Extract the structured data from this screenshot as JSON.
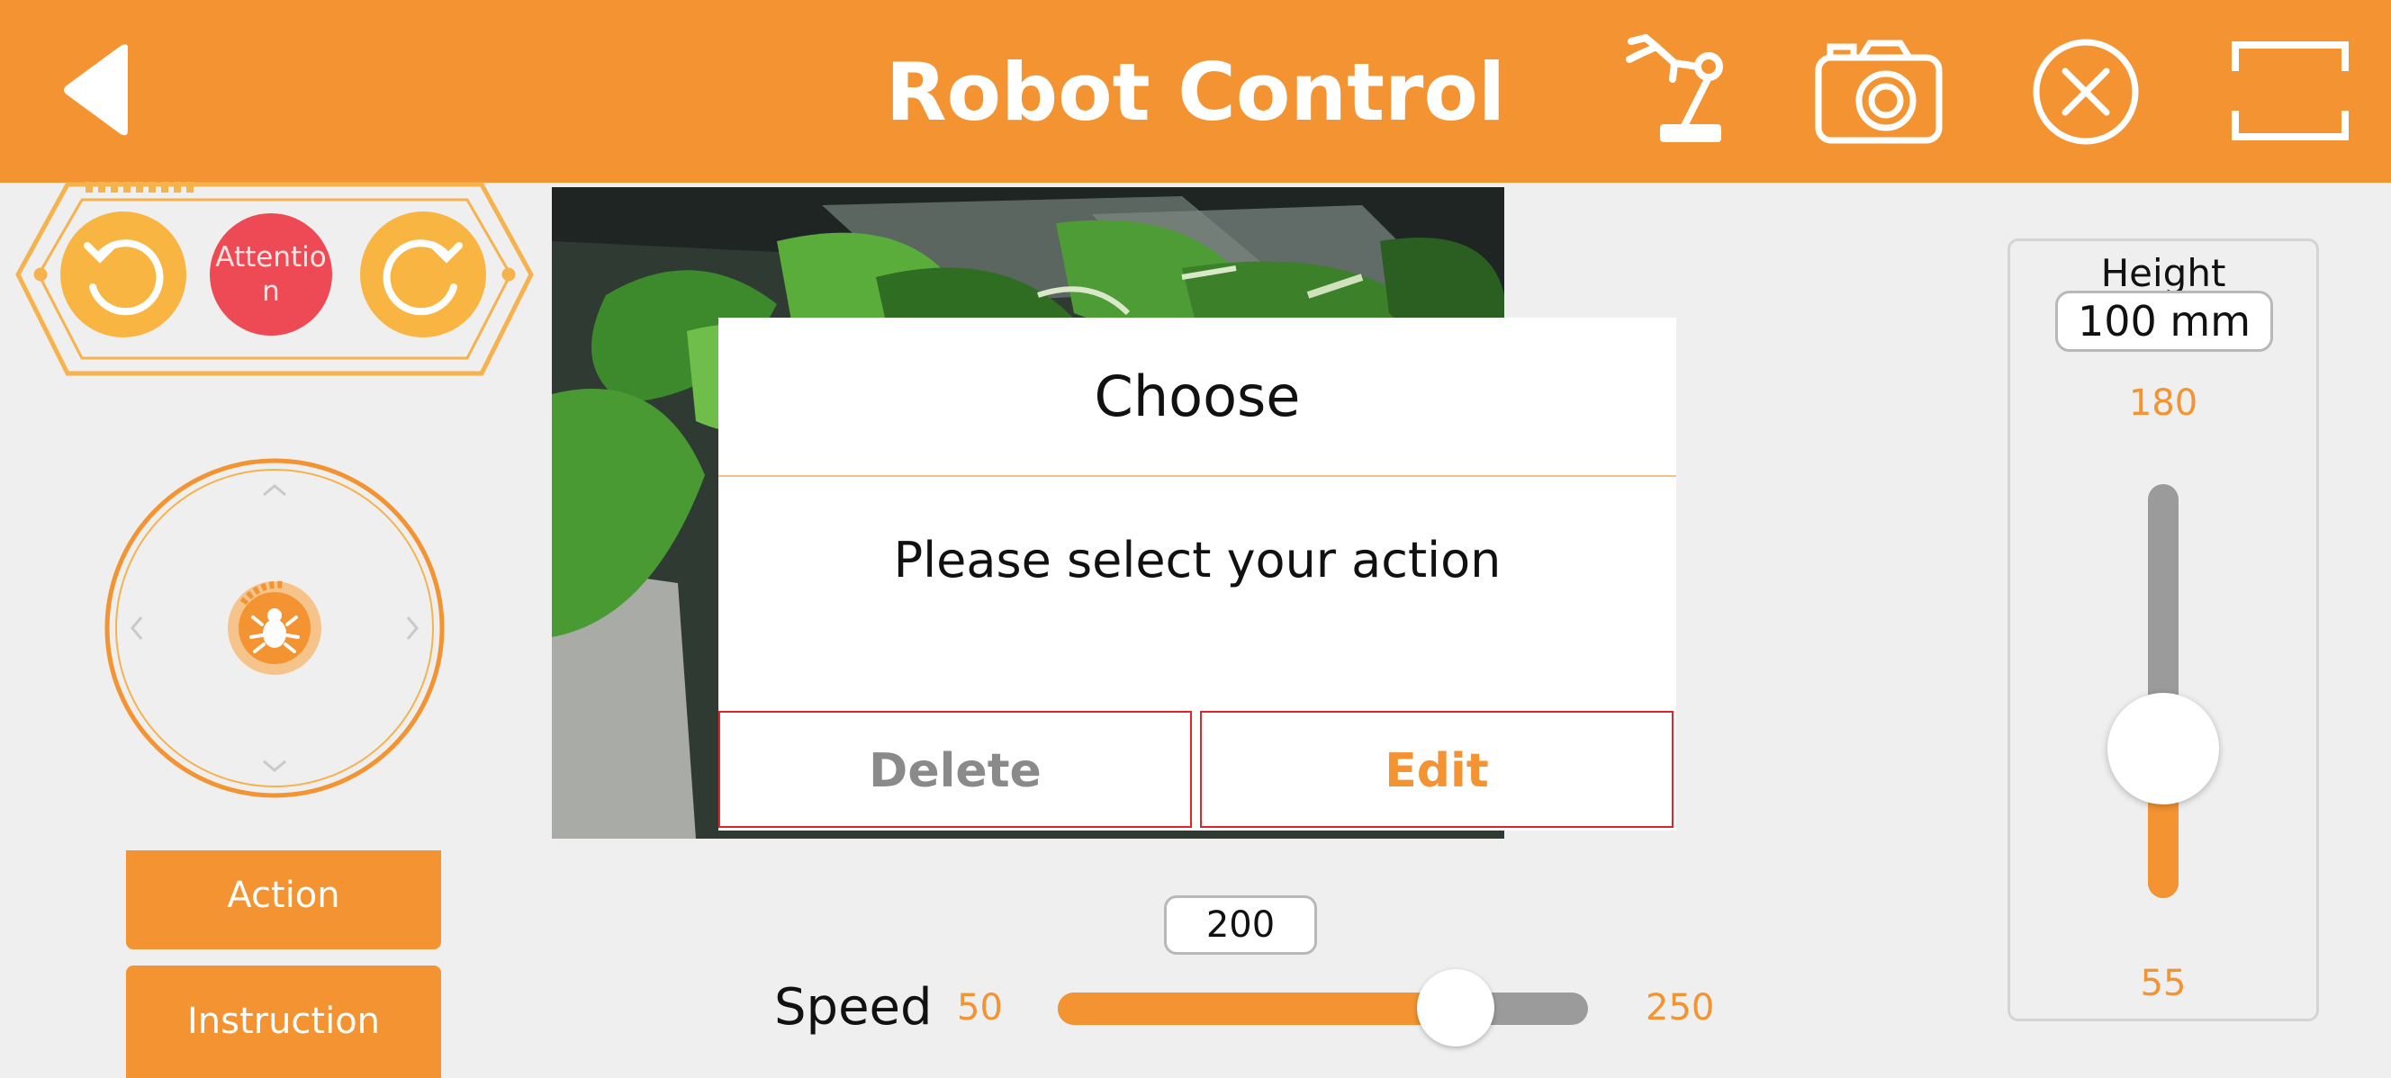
{
  "header": {
    "title": "Robot Control",
    "back_icon": "back-arrow-icon",
    "icons": [
      "robot-arm-icon",
      "camera-icon",
      "close-circle-icon",
      "fullscreen-icon"
    ]
  },
  "control_panel": {
    "rotate_left_icon": "rotate-left-icon",
    "attention_label": "Attention",
    "rotate_right_icon": "rotate-right-icon"
  },
  "joystick": {
    "center_icon": "spider-icon"
  },
  "buttons": {
    "action": "Action",
    "instruction": "Instruction"
  },
  "dialog": {
    "title": "Choose",
    "message": "Please select your action",
    "delete_label": "Delete",
    "edit_label": "Edit"
  },
  "speed": {
    "label": "Speed",
    "min": "50",
    "max": "250",
    "value": "200",
    "level": 0.75
  },
  "height": {
    "label": "Height",
    "value": "100 mm",
    "max": "180",
    "min": "55",
    "level": 0.36
  },
  "colors": {
    "accent": "#f39331",
    "attention": "#ee4a55",
    "dialog_border": "#e0262b",
    "delete_text": "#8a8a8a"
  }
}
